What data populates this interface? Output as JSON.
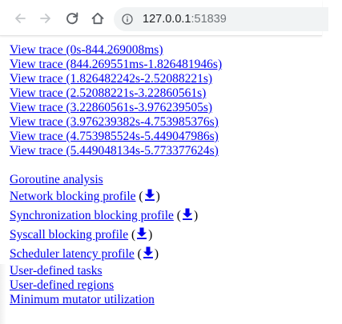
{
  "browser": {
    "url_host": "127.0.0.1",
    "url_port": ":51839"
  },
  "traces": [
    {
      "label": "View trace (0s-844.269008ms)"
    },
    {
      "label": "View trace (844.269551ms-1.826481946s)"
    },
    {
      "label": "View trace (1.826482242s-2.52088221s)"
    },
    {
      "label": "View trace (2.52088221s-3.22860561s)"
    },
    {
      "label": "View trace (3.22860561s-3.976239505s)"
    },
    {
      "label": "View trace (3.976239382s-4.753985376s)"
    },
    {
      "label": "View trace (4.753985524s-5.449047986s)"
    },
    {
      "label": "View trace (5.449048134s-5.773377624s)"
    }
  ],
  "analysis": {
    "goroutine": "Goroutine analysis",
    "network": "Network blocking profile",
    "sync": "Synchronization blocking profile",
    "syscall": "Syscall blocking profile",
    "sched": "Scheduler latency profile",
    "tasks": "User-defined tasks",
    "regions": "User-defined regions",
    "mmu": "Minimum mutator utilization",
    "open_paren": "(",
    "close_paren": ")"
  },
  "colors": {
    "link": "#0000ee",
    "toolbar_icon": "#5f6368",
    "omnibox_bg": "#f1f3f4"
  },
  "icons": {
    "back": "arrow-left-icon",
    "forward": "arrow-right-icon",
    "reload": "reload-icon",
    "home": "home-icon",
    "info": "info-icon",
    "download": "download-arrow-icon"
  }
}
